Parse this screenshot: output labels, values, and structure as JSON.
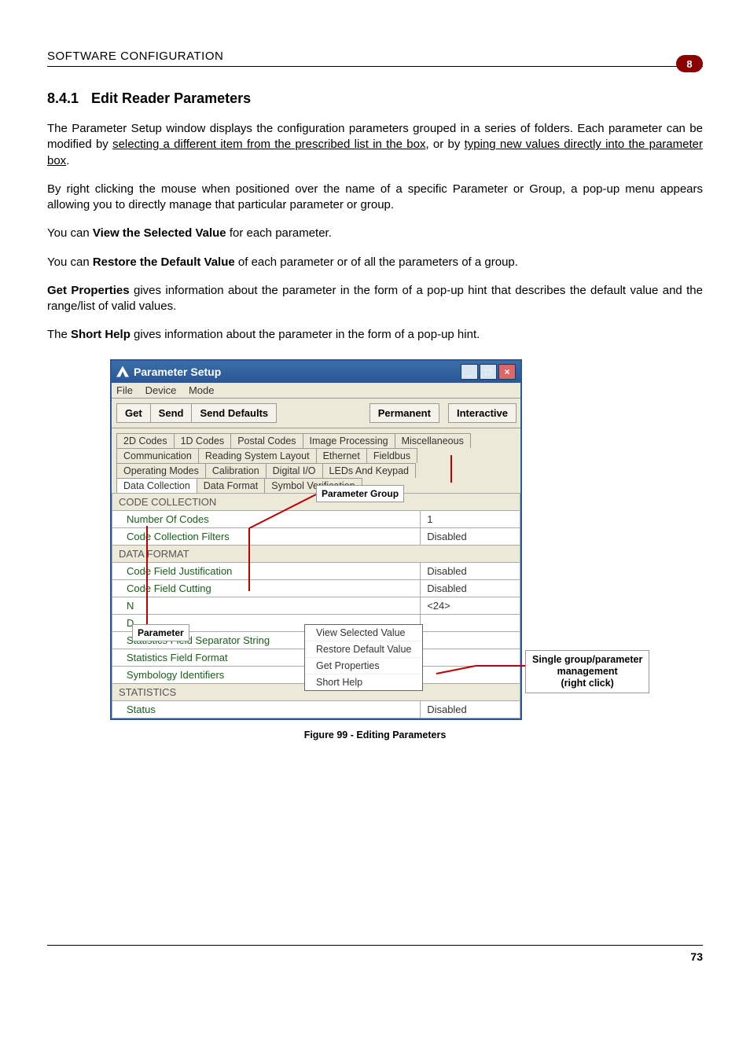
{
  "header": {
    "title": "SOFTWARE CONFIGURATION",
    "badge": "8"
  },
  "section": {
    "num": "8.4.1",
    "title": "Edit Reader Parameters"
  },
  "paras": {
    "p1a": "The Parameter Setup window displays the configuration parameters grouped in a series of folders. Each parameter can be modified by ",
    "p1u1": "selecting a different item from the prescribed list in the box",
    "p1b": ", or by ",
    "p1u2": "typing new values directly into the parameter box",
    "p1c": ".",
    "p2": "By right clicking the mouse when positioned over the name of a specific Parameter or Group, a pop-up menu appears allowing you to directly manage that particular parameter or group.",
    "p3a": "You can ",
    "p3b": "View the Selected Value",
    "p3c": " for each parameter.",
    "p4a": "You can ",
    "p4b": "Restore the Default Value",
    "p4c": " of each parameter or of all the parameters of a group.",
    "p5a": "Get Properties",
    "p5b": " gives information about the parameter in the form of a pop-up hint that describes the default value and the range/list of valid values.",
    "p6a": "The ",
    "p6b": "Short Help",
    "p6c": " gives information about the parameter in the form of a pop-up hint."
  },
  "win": {
    "title": "Parameter Setup",
    "menu": [
      "File",
      "Device",
      "Mode"
    ],
    "toolbar": [
      "Get",
      "Send",
      "Send Defaults",
      "Permanent",
      "Interactive"
    ],
    "tabs_r1": [
      "2D Codes",
      "1D Codes",
      "Postal Codes",
      "Image Processing",
      "Miscellaneous"
    ],
    "tabs_r2": [
      "Communication",
      "Reading System Layout",
      "Ethernet",
      "Fieldbus"
    ],
    "tabs_r3": [
      "Operating Modes",
      "Calibration",
      "Digital I/O",
      "LEDs And Keypad"
    ],
    "tabs_r4": [
      "Data Collection",
      "Data Format",
      "Symbol Verification"
    ]
  },
  "rows": {
    "g1": "CODE COLLECTION",
    "r1l": "Number Of Codes",
    "r1v": "1",
    "r2l": "Code Collection Filters",
    "r2v": "Disabled",
    "g2": "DATA FORMAT",
    "r3l": "Code Field Justification",
    "r3v": "Disabled",
    "r4l": "Code Field Cutting",
    "r4v": "Disabled",
    "r5l": "N",
    "r5v": "<24>",
    "r6l": "D",
    "r7l": "Statistics Field Separator String",
    "r8l": "Statistics Field Format",
    "r9l": "Symbology Identifiers",
    "g3": "STATISTICS",
    "r10l": "Status",
    "r10v": "Disabled"
  },
  "callouts": {
    "pgroup": "Parameter Group",
    "param": "Parameter",
    "right1": "Single group/parameter",
    "right2": "management",
    "right3": "(right click)"
  },
  "ctx": [
    "View Selected Value",
    "Restore Default Value",
    "Get Properties",
    "Short Help"
  ],
  "figcap": "Figure 99 - Editing Parameters",
  "pagenum": "73"
}
